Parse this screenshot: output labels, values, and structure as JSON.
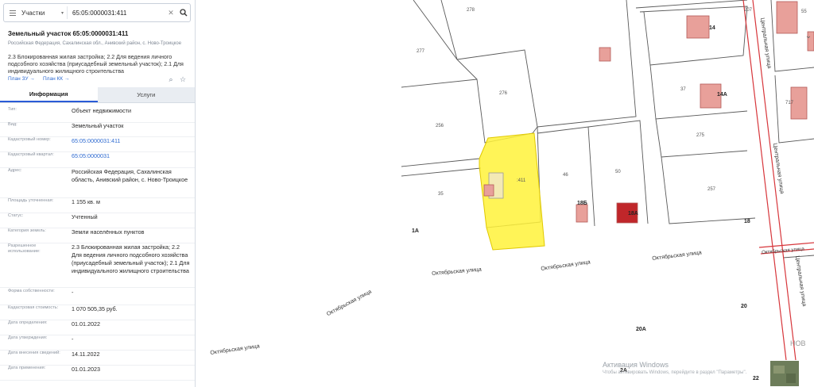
{
  "search": {
    "layer": "Участки",
    "value": "65:05:0000031:411"
  },
  "card": {
    "title": "Земельный участок 65:05:0000031:411",
    "address_small": "Российская Федерация, Сахалинская обл., Анивский район, с. Ново-Троицкое",
    "purpose": "2.3 Блокированная жилая застройка; 2.2 Для ведения личного подсобного хозяйства (приусадебный земельный участок); 2.1 Для индивидуального жилищного строительства",
    "link_plan_zu": "План ЗУ →",
    "link_plan_kk": "План КК →"
  },
  "tabs": {
    "info": "Информация",
    "services": "Услуги"
  },
  "info_rows": [
    {
      "key": "Тип:",
      "value": "Объект недвижимости"
    },
    {
      "key": "Вид:",
      "value": "Земельный участок"
    },
    {
      "key": "Кадастровый номер:",
      "value": "65:05:0000031:411"
    },
    {
      "key": "Кадастровый квартал:",
      "value": "65:05:0000031"
    },
    {
      "key": "Адрес:",
      "value": "Российская Федерация, Сахалинская область, Анивский район, с. Ново-Троицкое"
    },
    {
      "key": "Площадь уточненная:",
      "value": "1 155 кв. м"
    },
    {
      "key": "Статус:",
      "value": "Учтенный"
    },
    {
      "key": "Категория земель:",
      "value": "Земли населённых пунктов"
    },
    {
      "key": "Разрешенное использование:",
      "value": "2.3 Блокированная жилая застройка; 2.2 Для ведения личного подсобного хозяйства (приусадебный земельный участок); 2.1 Для индивидуального жилищного строительства"
    },
    {
      "key": "Форма собственности:",
      "value": "-"
    },
    {
      "key": "Кадастровая стоимость:",
      "value": "1 070 505,35 руб."
    },
    {
      "key": "Дата определения:",
      "value": "01.01.2022"
    },
    {
      "key": "Дата утверждения:",
      "value": "-"
    },
    {
      "key": "Дата внесения сведений:",
      "value": "14.11.2022"
    },
    {
      "key": "Дата применения:",
      "value": "01.01.2023"
    }
  ],
  "map": {
    "parcel_numbers": {
      "p278": "278",
      "p277": "277",
      "p276": "276",
      "p256": "256",
      "p35": "35",
      "p411": ":411",
      "p46": "46",
      "p50": "50",
      "p37": "37",
      "p275": "275",
      "p257": "257",
      "p207": "207",
      "p55": "55",
      "p717": "717",
      "p13": "13"
    },
    "house_numbers": {
      "h14": "14",
      "h14a": "14А",
      "h18b": "18Б",
      "h18a": "18А",
      "h18": "18",
      "h1a": "1А",
      "h20": "20",
      "h20a": "20А",
      "h2a": "2А",
      "h22": "22",
      "h22b": "22",
      "h16": "16",
      "h13": "13"
    },
    "streets": {
      "oct1": "Октябрьская улица",
      "oct2": "Октябрьская улица",
      "oct3": "Октябрьская улица",
      "oct4": "Октябрьская улица",
      "oct5": "Октябрьская улица",
      "cent1": "Центральная улица",
      "cent2": "Центральная улица",
      "cent3": "Центральная улица"
    },
    "nov_label": "НОВ",
    "watermark_title": "Активация Windows",
    "watermark_sub": "Чтобы активировать Windows, перейдите в раздел \"Параметры\"."
  },
  "colors": {
    "selected_parcel": "#fff23a",
    "building": "#e8a09a",
    "building_dark": "#c0262a",
    "red_line": "#d7363b",
    "parcel_line": "#555555",
    "link": "#2f6bd1"
  }
}
